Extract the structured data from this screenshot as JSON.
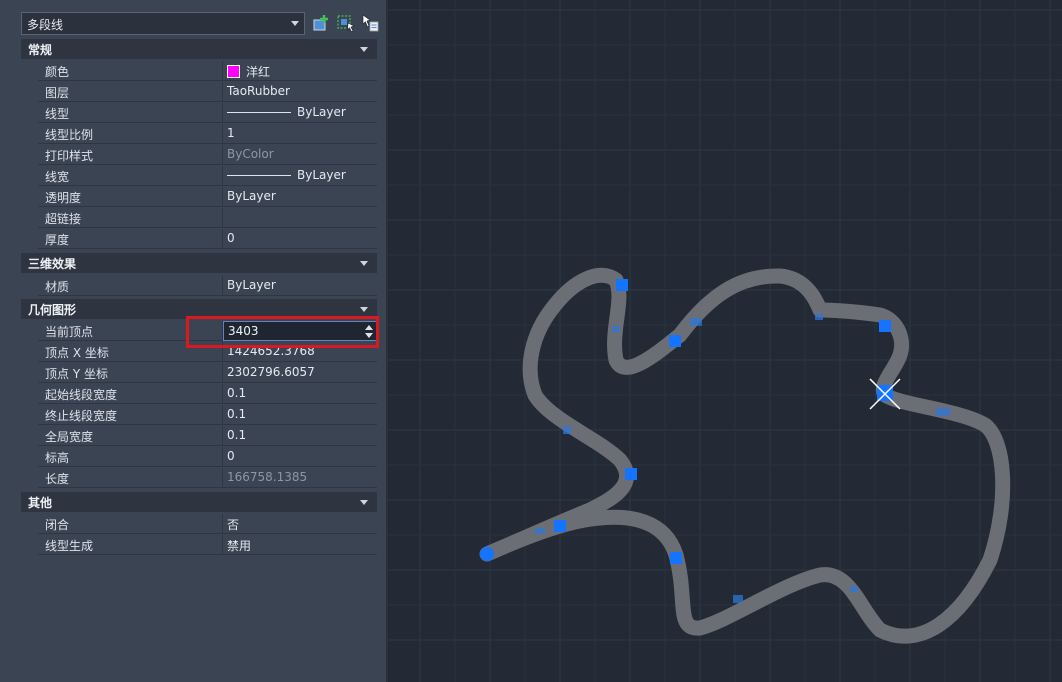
{
  "selector": {
    "value": "多段线"
  },
  "toolbar": {
    "icons": [
      "quick-select-icon",
      "select-objects-icon",
      "toggle-pickadd-icon"
    ]
  },
  "sections": {
    "general": "常规",
    "effects3d": "三维效果",
    "geometry": "几何图形",
    "misc": "其他"
  },
  "general": {
    "color": {
      "label": "颜色",
      "value": "洋红",
      "swatch": "#ff00ff"
    },
    "layer": {
      "label": "图层",
      "value": "TaoRubber"
    },
    "linetype": {
      "label": "线型",
      "value": "ByLayer"
    },
    "ltscale": {
      "label": "线型比例",
      "value": "1"
    },
    "plotstyle": {
      "label": "打印样式",
      "value": "ByColor"
    },
    "lineweight": {
      "label": "线宽",
      "value": "ByLayer"
    },
    "transparency": {
      "label": "透明度",
      "value": "ByLayer"
    },
    "hyperlink": {
      "label": "超链接",
      "value": ""
    },
    "thickness": {
      "label": "厚度",
      "value": "0"
    }
  },
  "effects3d": {
    "material": {
      "label": "材质",
      "value": "ByLayer"
    }
  },
  "geometry": {
    "current_vertex": {
      "label": "当前顶点",
      "value": "3403"
    },
    "vertex_x": {
      "label": "顶点 X 坐标",
      "value": "1424652.3768"
    },
    "vertex_y": {
      "label": "顶点 Y 坐标",
      "value": "2302796.6057"
    },
    "start_width": {
      "label": "起始线段宽度",
      "value": "0.1"
    },
    "end_width": {
      "label": "终止线段宽度",
      "value": "0.1"
    },
    "global_width": {
      "label": "全局宽度",
      "value": "0.1"
    },
    "elevation": {
      "label": "标高",
      "value": "0"
    },
    "length": {
      "label": "长度",
      "value": "166758.1385"
    }
  },
  "misc": {
    "closed": {
      "label": "闭合",
      "value": "否"
    },
    "linetype_gen": {
      "label": "线型生成",
      "value": "禁用"
    }
  },
  "colors": {
    "polyline": "#6b6f75",
    "grip": "#1473ff",
    "highlight": "#d9191f",
    "accent_magenta": "#ff00ff"
  }
}
